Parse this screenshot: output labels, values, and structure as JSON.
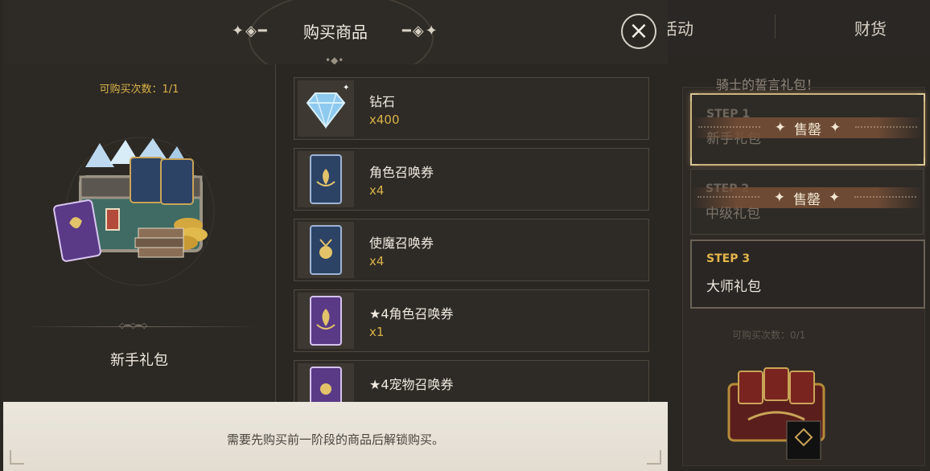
{
  "background": {
    "tabs": [
      "活动",
      "财货"
    ],
    "panel_title": "骑士的誓言礼包！",
    "remaining": "可购买次数：0/1",
    "steps": [
      {
        "label": "STEP 1",
        "name": "新手礼包",
        "sold_out": "售罄"
      },
      {
        "label": "STEP 2",
        "name": "中级礼包",
        "sold_out": "售罄"
      },
      {
        "label": "STEP 3",
        "name": "大师礼包"
      }
    ]
  },
  "modal": {
    "title": "购买商品",
    "close_icon": "close-icon",
    "remaining": "可购买次数：1/1",
    "package_name": "新手礼包",
    "items": [
      {
        "name": "钻石",
        "qty": "x400",
        "icon": "diamond-icon"
      },
      {
        "name": "角色召唤券",
        "qty": "x4",
        "icon": "character-ticket-icon"
      },
      {
        "name": "使魔召唤券",
        "qty": "x4",
        "icon": "familiar-ticket-icon"
      },
      {
        "name": "★4角色召唤券",
        "qty": "x1",
        "icon": "4star-character-ticket-icon"
      },
      {
        "name": "★4宠物召唤券",
        "qty": "",
        "icon": "4star-pet-ticket-icon"
      }
    ],
    "footer_text": "需要先购买前一阶段的商品后解锁购买。"
  },
  "colors": {
    "accent_gold": "#d9b348",
    "card_blue": "#2c4366",
    "card_purple": "#5a3a86"
  }
}
